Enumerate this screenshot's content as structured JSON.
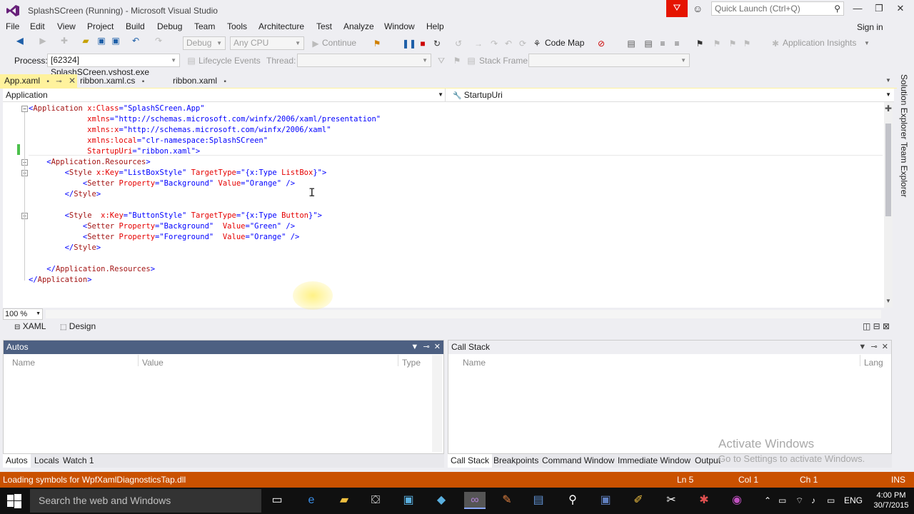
{
  "window": {
    "title": "SplashSCreen (Running) - Microsoft Visual Studio",
    "quick_launch_placeholder": "Quick Launch (Ctrl+Q)",
    "sign_in": "Sign in"
  },
  "menu": [
    "File",
    "Edit",
    "View",
    "Project",
    "Build",
    "Debug",
    "Team",
    "Tools",
    "Architecture",
    "Test",
    "Analyze",
    "Window",
    "Help"
  ],
  "toolbar1": {
    "config": "Debug",
    "platform": "Any CPU",
    "continue": "Continue",
    "code_map": "Code Map",
    "app_insights": "Application Insights"
  },
  "toolbar2": {
    "process_label": "Process:",
    "process_value": "[62324] SplashSCreen.vshost.exe",
    "lifecycle": "Lifecycle Events",
    "thread_label": "Thread:",
    "stack_frame_label": "Stack Frame:"
  },
  "tabs": [
    {
      "label": "App.xaml",
      "active": true
    },
    {
      "label": "ribbon.xaml.cs",
      "active": false
    },
    {
      "label": "ribbon.xaml",
      "active": false
    }
  ],
  "nav": {
    "left": "Application",
    "right": "StartupUri"
  },
  "code": [
    {
      "parts": [
        [
          "br",
          "<"
        ],
        [
          "tag",
          "Application"
        ],
        [
          "attr",
          " x:Class"
        ],
        [
          "br",
          "="
        ],
        [
          "val",
          "\"SplashSCreen.App\""
        ]
      ]
    },
    {
      "parts": [
        [
          "attr",
          "             xmlns"
        ],
        [
          "br",
          "="
        ],
        [
          "val",
          "\"http://schemas.microsoft.com/winfx/2006/xaml/presentation\""
        ]
      ]
    },
    {
      "parts": [
        [
          "attr",
          "             xmlns:x"
        ],
        [
          "br",
          "="
        ],
        [
          "val",
          "\"http://schemas.microsoft.com/winfx/2006/xaml\""
        ]
      ]
    },
    {
      "parts": [
        [
          "attr",
          "             xmlns:local"
        ],
        [
          "br",
          "="
        ],
        [
          "val",
          "\"clr-namespace:SplashSCreen\""
        ]
      ]
    },
    {
      "parts": [
        [
          "attr",
          "             StartupUri"
        ],
        [
          "br",
          "="
        ],
        [
          "val",
          "\"ribbon.xaml\""
        ],
        [
          "br",
          ">"
        ]
      ]
    },
    {
      "parts": [
        [
          "br",
          "    <"
        ],
        [
          "tag",
          "Application.Resources"
        ],
        [
          "br",
          ">"
        ]
      ]
    },
    {
      "parts": [
        [
          "br",
          "        <"
        ],
        [
          "tag",
          "Style"
        ],
        [
          "attr",
          " x:Key"
        ],
        [
          "br",
          "="
        ],
        [
          "val",
          "\"ListBoxStyle\""
        ],
        [
          "attr",
          " TargetType"
        ],
        [
          "br",
          "="
        ],
        [
          "val",
          "\"{x:Type "
        ],
        [
          "attr",
          "ListBox"
        ],
        [
          "val",
          "}\""
        ],
        [
          "br",
          ">"
        ]
      ]
    },
    {
      "parts": [
        [
          "br",
          "            <"
        ],
        [
          "tag",
          "Setter"
        ],
        [
          "attr",
          " Property"
        ],
        [
          "br",
          "="
        ],
        [
          "val",
          "\"Background\""
        ],
        [
          "attr",
          " Value"
        ],
        [
          "br",
          "="
        ],
        [
          "val",
          "\"Orange\""
        ],
        [
          "br",
          " />"
        ]
      ]
    },
    {
      "parts": [
        [
          "br",
          "        </"
        ],
        [
          "tag",
          "Style"
        ],
        [
          "br",
          ">"
        ]
      ]
    },
    {
      "parts": []
    },
    {
      "parts": [
        [
          "br",
          "        <"
        ],
        [
          "tag",
          "Style"
        ],
        [
          "attr",
          "  x:Key"
        ],
        [
          "br",
          "="
        ],
        [
          "val",
          "\"ButtonStyle\""
        ],
        [
          "attr",
          " TargetType"
        ],
        [
          "br",
          "="
        ],
        [
          "val",
          "\"{x:Type "
        ],
        [
          "attr",
          "Button"
        ],
        [
          "val",
          "}\""
        ],
        [
          "br",
          ">"
        ]
      ]
    },
    {
      "parts": [
        [
          "br",
          "            <"
        ],
        [
          "tag",
          "Setter"
        ],
        [
          "attr",
          " Property"
        ],
        [
          "br",
          "="
        ],
        [
          "val",
          "\"Background\""
        ],
        [
          "attr",
          "  Value"
        ],
        [
          "br",
          "="
        ],
        [
          "val",
          "\"Green\""
        ],
        [
          "br",
          " />"
        ]
      ]
    },
    {
      "parts": [
        [
          "br",
          "            <"
        ],
        [
          "tag",
          "Setter"
        ],
        [
          "attr",
          " Property"
        ],
        [
          "br",
          "="
        ],
        [
          "val",
          "\"Foreground\""
        ],
        [
          "attr",
          "  Value"
        ],
        [
          "br",
          "="
        ],
        [
          "val",
          "\"Orange\""
        ],
        [
          "br",
          " />"
        ]
      ]
    },
    {
      "parts": [
        [
          "br",
          "        </"
        ],
        [
          "tag",
          "Style"
        ],
        [
          "br",
          ">"
        ]
      ]
    },
    {
      "parts": []
    },
    {
      "parts": [
        [
          "br",
          "    </"
        ],
        [
          "tag",
          "Application.Resources"
        ],
        [
          "br",
          ">"
        ]
      ]
    },
    {
      "parts": [
        [
          "br",
          "</"
        ],
        [
          "tag",
          "Application"
        ],
        [
          "br",
          ">"
        ]
      ]
    }
  ],
  "editor": {
    "zoom": "100 %",
    "view_xaml": "XAML",
    "view_design": "Design"
  },
  "autos": {
    "title": "Autos",
    "columns": [
      "Name",
      "Value",
      "Type"
    ],
    "tabs": [
      "Autos",
      "Locals",
      "Watch 1"
    ]
  },
  "callstack": {
    "title": "Call Stack",
    "columns": [
      "Name",
      "Lang"
    ],
    "tabs": [
      "Call Stack",
      "Breakpoints",
      "Command Window",
      "Immediate Window",
      "Output"
    ]
  },
  "side_tabs": [
    "Solution Explorer",
    "Team Explorer"
  ],
  "status": {
    "message": "Loading symbols for WpfXamlDiagnosticsTap.dll",
    "ln": "Ln 5",
    "col": "Col 1",
    "ch": "Ch 1",
    "mode": "INS"
  },
  "watermark": {
    "line1": "Activate Windows",
    "line2": "Go to Settings to activate Windows."
  },
  "taskbar": {
    "search": "Search the web and Windows",
    "lang": "ENG",
    "time": "4:00 PM",
    "date": "30/7/2015"
  },
  "colors": {
    "status_bar": "#ca5100",
    "active_tab": "#fff29d",
    "filter_button": "#e51400"
  }
}
